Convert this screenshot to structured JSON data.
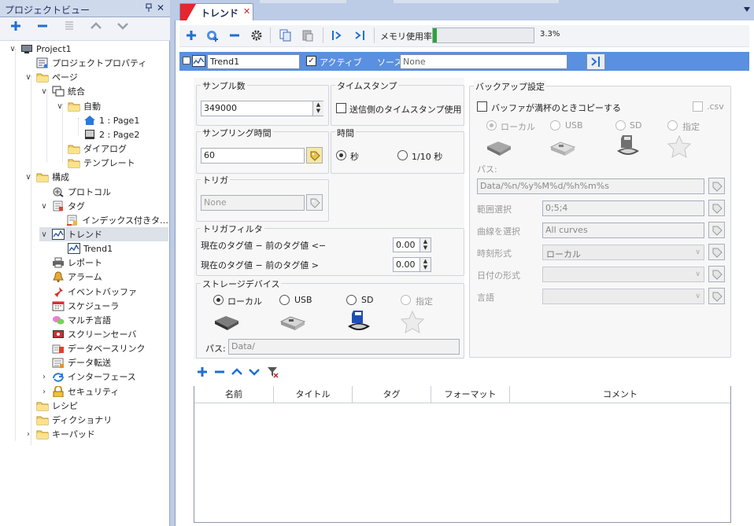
{
  "left_panel": {
    "title": "プロジェクトビュー",
    "pin": "ᵖ",
    "close": "✕",
    "tree": [
      {
        "label": "Project1",
        "indent": 0,
        "expander": "∨",
        "icon": "monitor-icon"
      },
      {
        "label": "プロジェクトプロパティ",
        "indent": 1,
        "expander": "",
        "icon": "properties-icon"
      },
      {
        "label": "ページ",
        "indent": 1,
        "expander": "∨",
        "icon": "folder-icon"
      },
      {
        "label": "統合",
        "indent": 2,
        "expander": "∨",
        "icon": "pages-icon"
      },
      {
        "label": "自動",
        "indent": 3,
        "expander": "∨",
        "icon": "folder-icon"
      },
      {
        "label": "1 : Page1",
        "indent": 4,
        "expander": "",
        "icon": "home-icon"
      },
      {
        "label": "2 : Page2",
        "indent": 4,
        "expander": "",
        "icon": "page-icon"
      },
      {
        "label": "ダイアログ",
        "indent": 3,
        "expander": "",
        "icon": "folder-icon"
      },
      {
        "label": "テンプレート",
        "indent": 3,
        "expander": "",
        "icon": "folder-icon"
      },
      {
        "label": "構成",
        "indent": 1,
        "expander": "∨",
        "icon": "folder-icon"
      },
      {
        "label": "プロトコル",
        "indent": 2,
        "expander": "",
        "icon": "protocol-icon"
      },
      {
        "label": "タグ",
        "indent": 2,
        "expander": "∨",
        "icon": "tag-icon"
      },
      {
        "label": "インデックス付きタ…",
        "indent": 3,
        "expander": "",
        "icon": "indexed-tag-icon"
      },
      {
        "label": "トレンド",
        "indent": 2,
        "expander": "∨",
        "icon": "trend-icon",
        "selected": true
      },
      {
        "label": "Trend1",
        "indent": 3,
        "expander": "",
        "icon": "trend-icon"
      },
      {
        "label": "レポート",
        "indent": 2,
        "expander": "",
        "icon": "printer-icon"
      },
      {
        "label": "アラーム",
        "indent": 2,
        "expander": "",
        "icon": "bell-icon"
      },
      {
        "label": "イベントバッファ",
        "indent": 2,
        "expander": "",
        "icon": "pin-icon"
      },
      {
        "label": "スケジューラ",
        "indent": 2,
        "expander": "",
        "icon": "calendar-icon"
      },
      {
        "label": "マルチ言語",
        "indent": 2,
        "expander": "",
        "icon": "speech-icon"
      },
      {
        "label": "スクリーンセーバ",
        "indent": 2,
        "expander": "",
        "icon": "screensaver-icon"
      },
      {
        "label": "データベースリンク",
        "indent": 2,
        "expander": "",
        "icon": "database-icon"
      },
      {
        "label": "データ転送",
        "indent": 2,
        "expander": "",
        "icon": "transfer-icon"
      },
      {
        "label": "インターフェース",
        "indent": 2,
        "expander": "›",
        "icon": "interface-icon"
      },
      {
        "label": "セキュリティ",
        "indent": 2,
        "expander": "›",
        "icon": "lock-icon"
      },
      {
        "label": "レシピ",
        "indent": 1,
        "expander": "",
        "icon": "folder-icon"
      },
      {
        "label": "ディクショナリ",
        "indent": 1,
        "expander": "",
        "icon": "folder-icon"
      },
      {
        "label": "キーパッド",
        "indent": 1,
        "expander": "›",
        "icon": "folder-icon"
      }
    ]
  },
  "tab": {
    "label": "トレンド",
    "close": "✕"
  },
  "toolbar": {
    "memory_label": "メモリ使用率",
    "memory_percent": "3.3%",
    "memory_fraction": 0.033
  },
  "trend_header": {
    "name": "Trend1",
    "active_label": "アクティブ",
    "active_checked": "✓",
    "source_label": "ソース",
    "source_value": "None"
  },
  "sampling": {
    "title": "サンプル数",
    "value": "349000"
  },
  "timestamp": {
    "title": "タイムスタンプ",
    "checkbox_label": "送信側のタイムスタンプ使用"
  },
  "sampling_time": {
    "title": "サンプリング時間",
    "value": "60"
  },
  "time": {
    "title": "時間",
    "option1": "秒",
    "option2": "1/10 秒"
  },
  "trigger": {
    "title": "トリガ",
    "value": "None"
  },
  "trigger_filter": {
    "title": "トリガフィルタ",
    "row1_label": "現在のタグ値 − 前のタグ値 <−",
    "row1_value": "0.00",
    "row2_label": "現在のタグ値 − 前のタグ値 >",
    "row2_value": "0.00"
  },
  "storage": {
    "title": "ストレージデバイス",
    "local": "ローカル",
    "usb": "USB",
    "sd": "SD",
    "custom": "指定",
    "path_label": "パス:",
    "path_value": "Data/"
  },
  "backup": {
    "title": "バックアップ設定",
    "copy_label": "バッファが満杯のときコピーする",
    "csv_label": ".csv",
    "local": "ローカル",
    "usb": "USB",
    "sd": "SD",
    "custom": "指定",
    "path_label": "パス:",
    "path_value": "Data/%n/%y%M%d/%h%m%s",
    "range_label": "範囲選択",
    "range_value": "0;5;4",
    "curve_label": "曲線を選択",
    "curve_value": "All curves",
    "time_format_label": "時刻形式",
    "time_format_value": "ローカル",
    "date_format_label": "日付の形式",
    "date_format_value": "",
    "language_label": "言語",
    "language_value": ""
  },
  "grid": {
    "columns": [
      "名前",
      "タイトル",
      "タグ",
      "フォーマット",
      "コメント"
    ]
  },
  "colors": {
    "accent": "#5a90df",
    "memory_fill": "#2aa538",
    "plus": "#1f6fd6",
    "close": "#c0262d"
  }
}
